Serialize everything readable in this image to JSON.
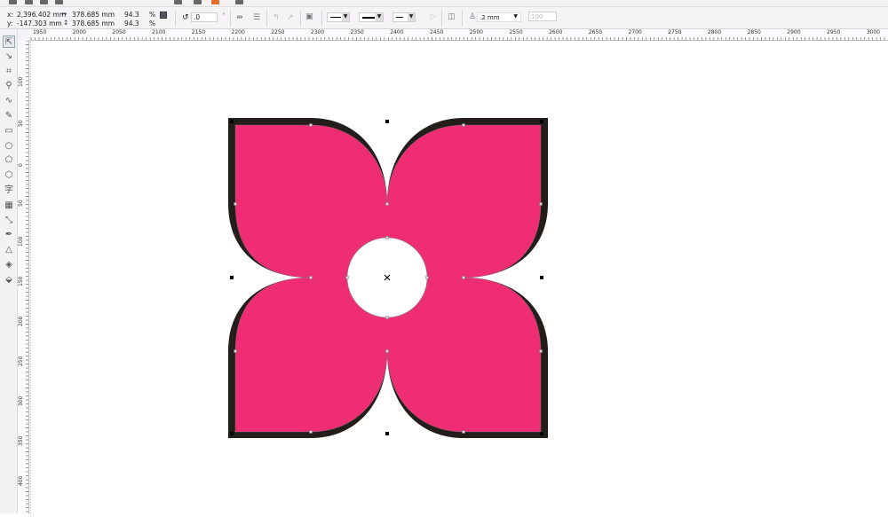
{
  "property_bar": {
    "x_label": "x:",
    "x_value": "2,396.402 mm",
    "y_label": "y:",
    "y_value": "-147.303 mm",
    "width_value": "378.685 mm",
    "height_value": "378.685 mm",
    "scale_x": "94.3",
    "scale_y": "94.3",
    "percent": "%",
    "rotation_value": ".0",
    "degree": "°",
    "outline_width": ".2 mm",
    "transparency": "100"
  },
  "ruler": {
    "horizontal_labels": [
      "1950",
      "2000",
      "2050",
      "2100",
      "2150",
      "2200",
      "2250",
      "2300",
      "2350",
      "2400",
      "2450",
      "2500",
      "2550",
      "2600",
      "2650",
      "2700",
      "2750",
      "2800",
      "2850",
      "2900",
      "2950",
      "3000"
    ],
    "vertical_labels": [
      "100",
      "50",
      "0",
      "50",
      "100",
      "150",
      "200",
      "250",
      "300",
      "350",
      "400"
    ]
  },
  "toolbox": [
    "pick-tool",
    "shape-tool",
    "crop-tool",
    "zoom-tool",
    "freehand-tool",
    "artistic-media-tool",
    "rectangle-tool",
    "ellipse-tool",
    "polygon-tool",
    "basic-shapes-tool",
    "text-tool",
    "table-tool",
    "dimension-tool",
    "eyedropper-tool",
    "outline-tool",
    "fill-tool",
    "interactive-fill-tool"
  ],
  "colors": {
    "fill": "#ee2d72",
    "shadow": "#231e1c",
    "hole": "#ffffff"
  }
}
